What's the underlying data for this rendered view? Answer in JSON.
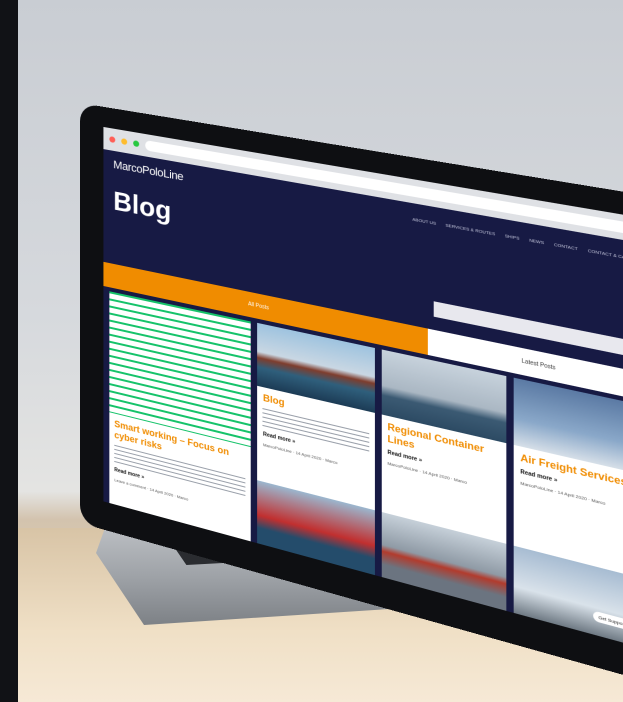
{
  "page": {
    "site_logo": "MarcoPoloLine",
    "page_title": "Blog",
    "nav_items": [
      "ABOUT US",
      "SERVICES & ROUTES",
      "SHIPS",
      "NEWS",
      "CONTACT",
      "CONTACT & CAREERS"
    ],
    "tab_active_label": "All Posts",
    "tab_inactive_label": "Latest Posts",
    "chat_label": "Get Support Quick"
  },
  "cards": [
    {
      "title": "Smart working – Focus on cyber risks",
      "read_more": "Read more »",
      "meta": "Leave a comment · 14 April 2020 · Marco"
    },
    {
      "title": "Blog",
      "read_more": "Read more »",
      "meta": "MarcoPoloLine · 14 April 2020 · Marco"
    },
    {
      "title": "Regional Container Lines",
      "read_more": "Read more »",
      "meta": "MarcoPoloLine · 14 April 2020 · Marco"
    },
    {
      "title": "Air Freight Services",
      "read_more": "Read more »",
      "meta": "MarcoPoloLine · 14 April 2020 · Marco"
    }
  ],
  "colors": {
    "site_background": "#171a44",
    "accent_orange": "#f08c00",
    "card_background": "#ffffff"
  }
}
